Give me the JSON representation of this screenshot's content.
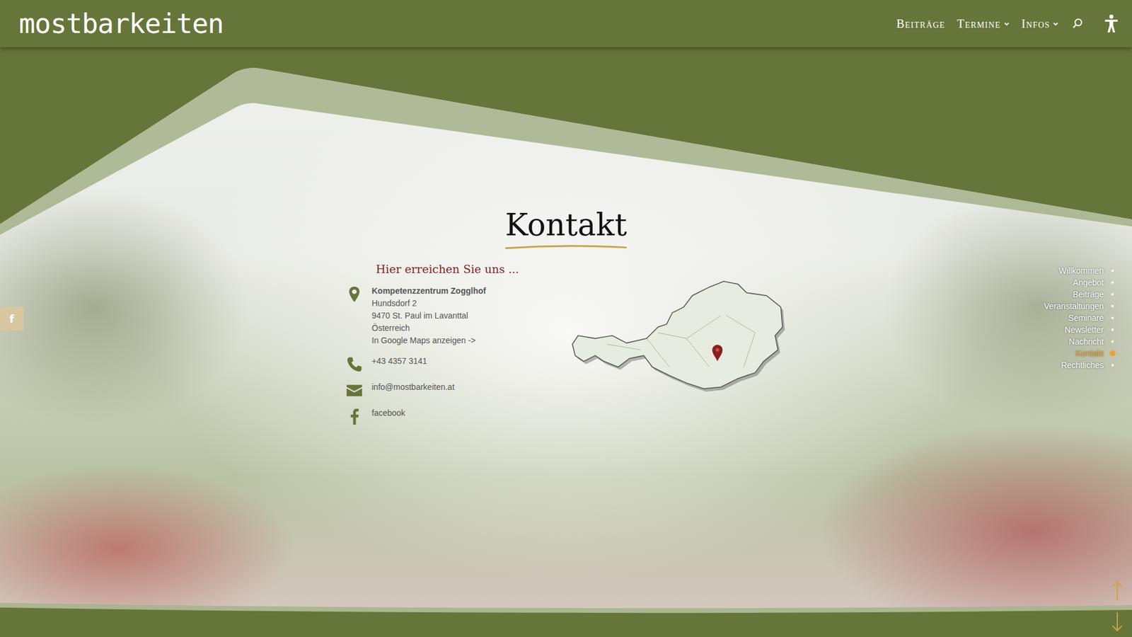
{
  "header": {
    "logo": "mostbarkeiten",
    "nav": [
      {
        "label": "Beiträge",
        "dropdown": false
      },
      {
        "label": "Termine",
        "dropdown": true
      },
      {
        "label": "Infos",
        "dropdown": true
      }
    ]
  },
  "social_tab": "f",
  "section": {
    "title": "Kontakt",
    "subtitle": "Hier erreichen Sie uns ..."
  },
  "contacts": [
    {
      "kind": "address",
      "heading": "Kompetenzzentrum Zogglhof",
      "lines": [
        "Hundsdorf 2",
        "9470 St. Paul im Lavanttal",
        "Österreich"
      ],
      "link": "In Google Maps anzeigen ->"
    },
    {
      "kind": "phone",
      "heading": "",
      "lines": [
        "+43 4357 3141"
      ],
      "link": ""
    },
    {
      "kind": "mail",
      "heading": "",
      "lines": [
        "info@mostbarkeiten.at"
      ],
      "link": ""
    },
    {
      "kind": "facebook",
      "heading": "",
      "lines": [
        "facebook"
      ],
      "link": ""
    }
  ],
  "side_nav": [
    {
      "label": "Willkommen",
      "selected": false
    },
    {
      "label": "Angebot",
      "selected": false
    },
    {
      "label": "Beiträge",
      "selected": false
    },
    {
      "label": "Veranstaltungen",
      "selected": false
    },
    {
      "label": "Seminare",
      "selected": false
    },
    {
      "label": "Newsletter",
      "selected": false
    },
    {
      "label": "Nachricht",
      "selected": false
    },
    {
      "label": "Kontakt",
      "selected": true
    },
    {
      "label": "Rechtliches",
      "selected": false
    }
  ]
}
